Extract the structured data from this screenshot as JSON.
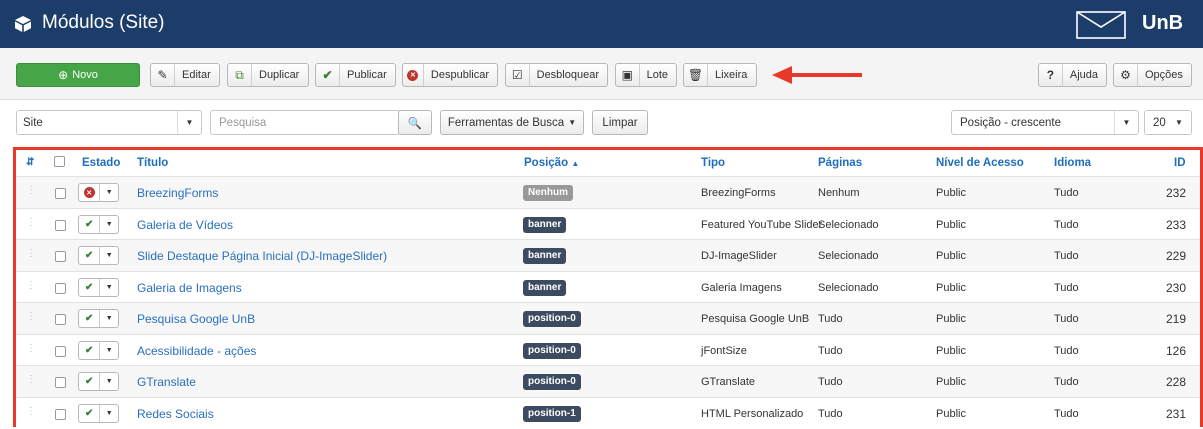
{
  "header": {
    "title": "Módulos (Site)",
    "brand": "UnB",
    "bg_color": "#1c3d6a"
  },
  "toolbar": {
    "new_label": "Novo",
    "edit_label": "Editar",
    "duplicate_label": "Duplicar",
    "publish_label": "Publicar",
    "unpublish_label": "Despublicar",
    "unlock_label": "Desbloquear",
    "batch_label": "Lote",
    "trash_label": "Lixeira",
    "help_label": "Ajuda",
    "options_label": "Opções",
    "accent_color": "#e8392b"
  },
  "filters": {
    "client_value": "Site",
    "search_placeholder": "Pesquisa",
    "search_tools_label": "Ferramentas de Busca",
    "clear_label": "Limpar",
    "order_value": "Posição - crescente",
    "limit_value": "20"
  },
  "columns": {
    "state": "Estado",
    "title": "Título",
    "position": "Posição",
    "type": "Tipo",
    "pages": "Páginas",
    "access": "Nível de Acesso",
    "language": "Idioma",
    "id": "ID"
  },
  "rows": [
    {
      "status": "unpublished",
      "title": "BreezingForms",
      "position": "Nenhum",
      "type": "BreezingForms",
      "pages": "Nenhum",
      "access": "Public",
      "language": "Tudo",
      "id": "232"
    },
    {
      "status": "published",
      "title": "Galeria de Vídeos",
      "position": "banner",
      "type": "Featured YouTube Slider",
      "pages": "Selecionado",
      "access": "Public",
      "language": "Tudo",
      "id": "233"
    },
    {
      "status": "published",
      "title": "Slide Destaque Página Inicial (DJ-ImageSlider)",
      "position": "banner",
      "type": "DJ-ImageSlider",
      "pages": "Selecionado",
      "access": "Public",
      "language": "Tudo",
      "id": "229"
    },
    {
      "status": "published",
      "title": "Galeria de Imagens",
      "position": "banner",
      "type": "Galeria Imagens",
      "pages": "Selecionado",
      "access": "Public",
      "language": "Tudo",
      "id": "230"
    },
    {
      "status": "published",
      "title": "Pesquisa Google UnB",
      "position": "position-0",
      "type": "Pesquisa Google UnB",
      "pages": "Tudo",
      "access": "Public",
      "language": "Tudo",
      "id": "219"
    },
    {
      "status": "published",
      "title": "Acessibilidade - ações",
      "position": "position-0",
      "type": "jFontSize",
      "pages": "Tudo",
      "access": "Public",
      "language": "Tudo",
      "id": "126"
    },
    {
      "status": "published",
      "title": "GTranslate",
      "position": "position-0",
      "type": "GTranslate",
      "pages": "Tudo",
      "access": "Public",
      "language": "Tudo",
      "id": "228"
    },
    {
      "status": "published",
      "title": "Redes Sociais",
      "position": "position-1",
      "type": "HTML Personalizado",
      "pages": "Tudo",
      "access": "Public",
      "language": "Tudo",
      "id": "231"
    }
  ]
}
